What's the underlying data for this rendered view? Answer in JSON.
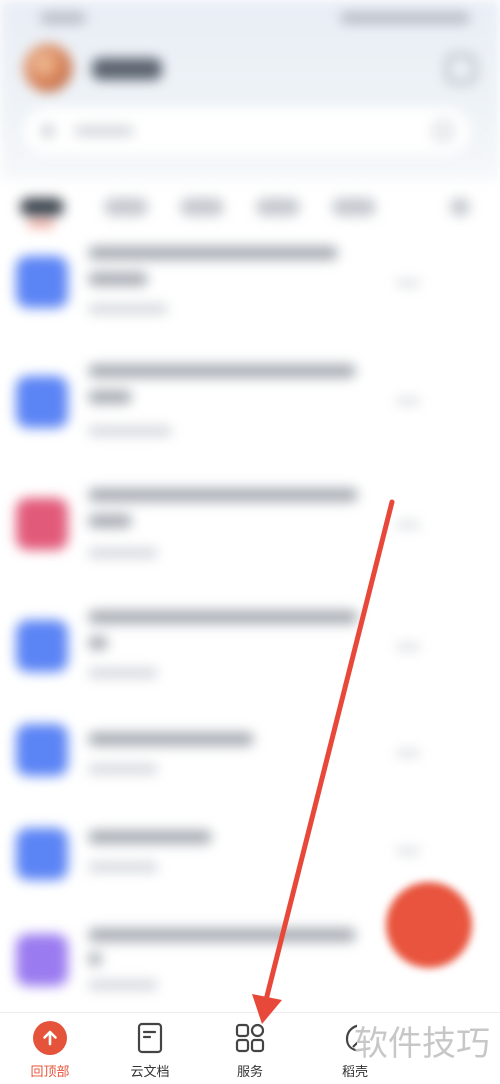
{
  "bottom_nav": {
    "items": [
      {
        "label": "回顶部",
        "icon": "arrow-up-icon",
        "active": true
      },
      {
        "label": "云文档",
        "icon": "document-icon",
        "active": false
      },
      {
        "label": "服务",
        "icon": "grid-icon",
        "active": false
      },
      {
        "label": "稻壳",
        "icon": "leaf-icon",
        "active": false
      }
    ]
  },
  "watermark": {
    "text": "软件技巧"
  },
  "colors": {
    "accent": "#e5533a",
    "file_blue": "#5b84f5",
    "file_pink": "#e25a7a",
    "file_purple": "#9b7bf0"
  }
}
